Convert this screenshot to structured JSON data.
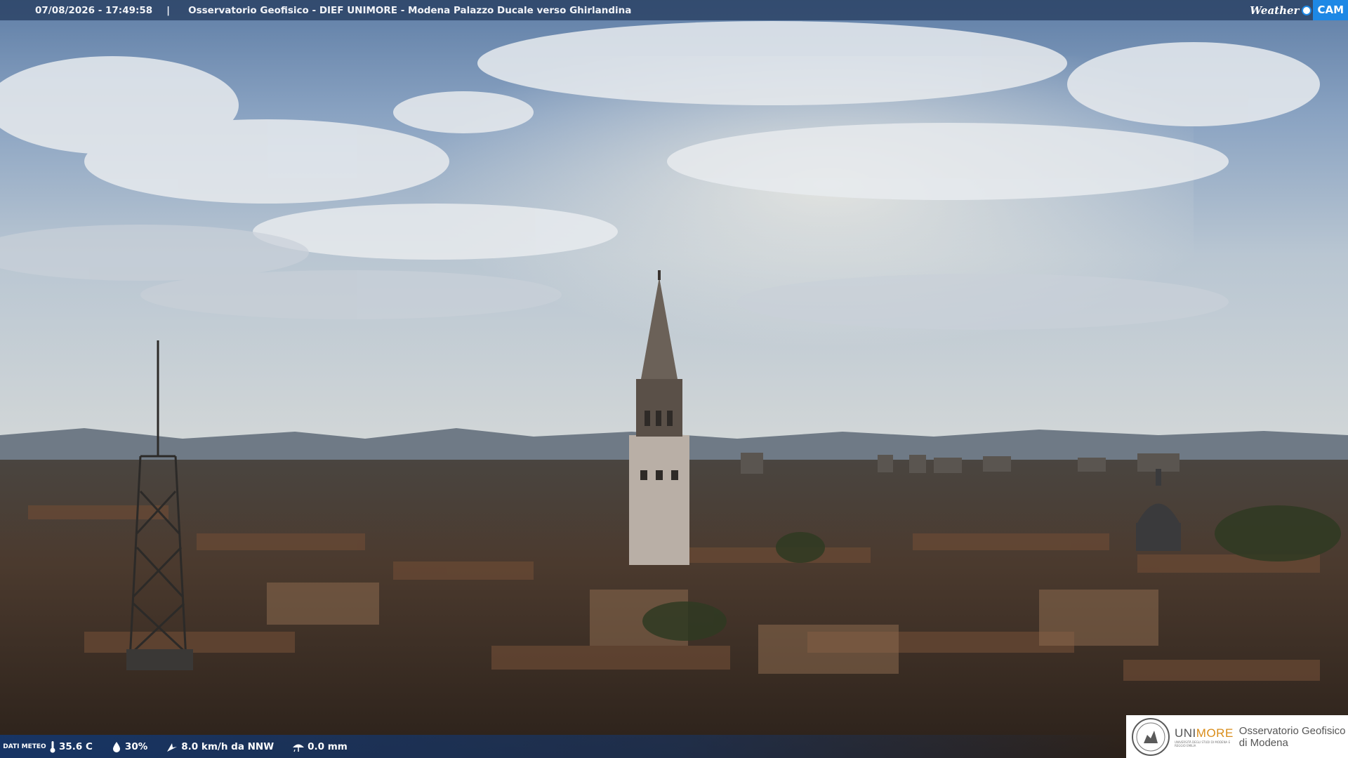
{
  "top_bar": {
    "timestamp": "07/08/2026 - 17:49:58",
    "separator": "|",
    "location": "Osservatorio Geofisico - DIEF UNIMORE - Modena Palazzo Ducale verso Ghirlandina"
  },
  "brand": {
    "weather": "Weather",
    "cam": "CAM",
    "accent_color": "#1e88e5"
  },
  "weather_bar": {
    "label": "DATI METEO",
    "temperature": "35.6 C",
    "humidity": "30%",
    "wind": "8.0 km/h da NNW",
    "rain": "0.0 mm",
    "icons": [
      "thermometer-icon",
      "humidity-drop-icon",
      "wind-icon",
      "rain-icon"
    ]
  },
  "logo": {
    "uni": "UNI",
    "more": "MORE",
    "uni_subtitle": "UNIVERSITÀ DEGLI STUDI DI MODENA E REGGIO EMILIA",
    "observatory_line1": "Osservatorio Geofisico",
    "observatory_line2": "di Modena",
    "uni_color": "#555555",
    "more_color": "#d98c18"
  }
}
